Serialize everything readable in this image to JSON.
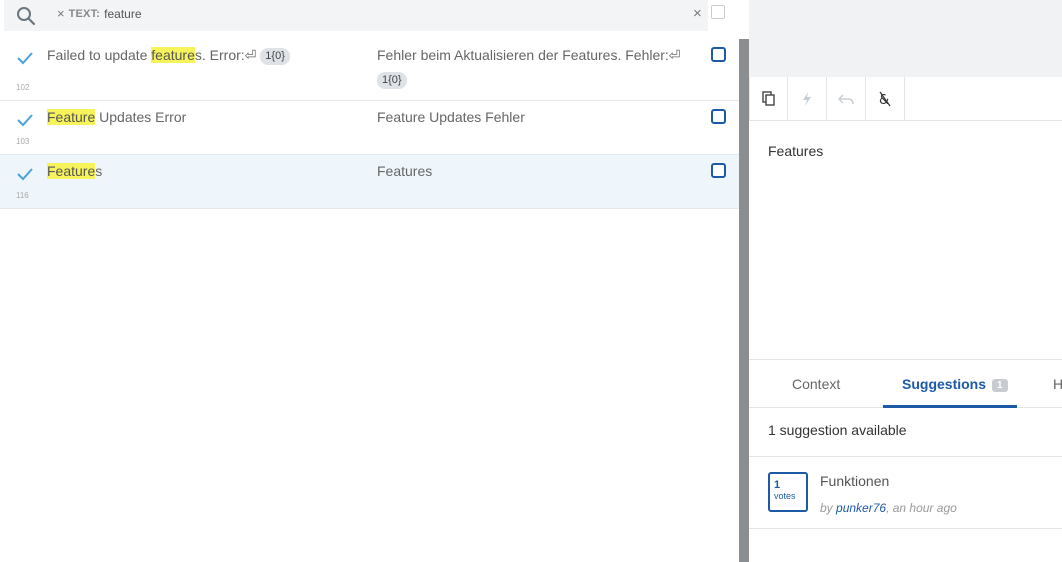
{
  "search": {
    "filter_key": "TEXT:",
    "filter_value": "feature",
    "chip_remove": "×",
    "clear": "×"
  },
  "rows": [
    {
      "id": "102",
      "source_pre": "Failed to update ",
      "source_hl": "feature",
      "source_post": "s. Error:⏎",
      "source_ph": "1{0}",
      "target": "Fehler beim Aktualisieren der Features. Fehler:⏎",
      "target_ph": "1{0}",
      "selected": false
    },
    {
      "id": "103",
      "source_pre": "",
      "source_hl": "Feature",
      "source_post": " Updates Error",
      "target": "Feature Updates Fehler",
      "selected": false
    },
    {
      "id": "116",
      "source_pre": "",
      "source_hl": "Feature",
      "source_post": "s",
      "target": "Features",
      "selected": true
    }
  ],
  "editor": {
    "toolbar": [
      "copy-icon",
      "bolt-icon",
      "undo-icon",
      "special-char-icon"
    ],
    "text": "Features"
  },
  "tabs": {
    "context": "Context",
    "suggestions": "Suggestions",
    "suggestions_badge": "1",
    "history": "H"
  },
  "suggestions": {
    "count_text": "1 suggestion available",
    "items": [
      {
        "votes": "1",
        "votes_label": "votes",
        "text": "Funktionen",
        "by": "by ",
        "user": "punker76",
        "when": ", an hour ago"
      }
    ]
  },
  "colors": {
    "accent": "#1c5aa8",
    "highlight": "#f7f35a",
    "check": "#4aa3df"
  }
}
